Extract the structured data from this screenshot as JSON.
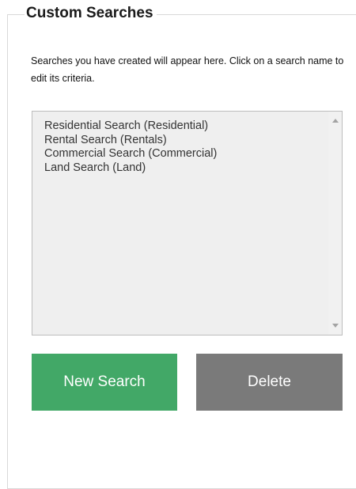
{
  "panel": {
    "title": "Custom Searches",
    "description": "Searches you have created will appear here. Click on a search name to edit its criteria."
  },
  "searches": [
    {
      "label": "Residential Search (Residential)"
    },
    {
      "label": "Rental Search (Rentals)"
    },
    {
      "label": "Commercial Search (Commercial)"
    },
    {
      "label": "Land Search (Land)"
    }
  ],
  "buttons": {
    "new_search": "New Search",
    "delete": "Delete"
  },
  "colors": {
    "new_search_bg": "#42a867",
    "delete_bg": "#7a7a7a",
    "listbox_bg": "#efefef"
  },
  "icons": {
    "scroll_up": "scroll-up-arrow-icon",
    "scroll_down": "scroll-down-arrow-icon"
  }
}
